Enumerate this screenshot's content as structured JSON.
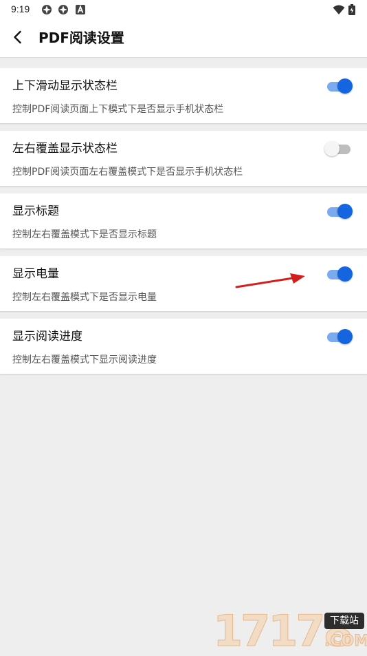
{
  "status_bar": {
    "time": "9:19",
    "icons": [
      "app-notification-icon",
      "app-notification-icon",
      "a-badge-icon",
      "wifi-icon",
      "battery-icon"
    ]
  },
  "header": {
    "title": "PDF阅读设置",
    "back_icon": "back-arrow-icon"
  },
  "settings": [
    {
      "title": "上下滑动显示状态栏",
      "description": "控制PDF阅读页面上下模式下是否显示手机状态栏",
      "enabled": true
    },
    {
      "title": "左右覆盖显示状态栏",
      "description": "控制PDF阅读页面左右覆盖模式下是否显示手机状态栏",
      "enabled": false
    },
    {
      "title": "显示标题",
      "description": "控制左右覆盖模式下是否显示标题",
      "enabled": true
    },
    {
      "title": "显示电量",
      "description": "控制左右覆盖模式下是否显示电量",
      "enabled": true
    },
    {
      "title": "显示阅读进度",
      "description": "控制左右覆盖模式下显示阅读进度",
      "enabled": true
    }
  ],
  "annotation": {
    "type": "red-arrow",
    "color": "#d41e1e"
  },
  "watermark": {
    "digits": "17178",
    "badge": "下载站",
    "domain": ".COM"
  },
  "colors": {
    "toggle_on_thumb": "#1565e0",
    "toggle_on_track": "#7aaaf0",
    "toggle_off_thumb": "#f5f5f5",
    "toggle_off_track": "#bdbdbd",
    "background": "#eeeeee"
  }
}
